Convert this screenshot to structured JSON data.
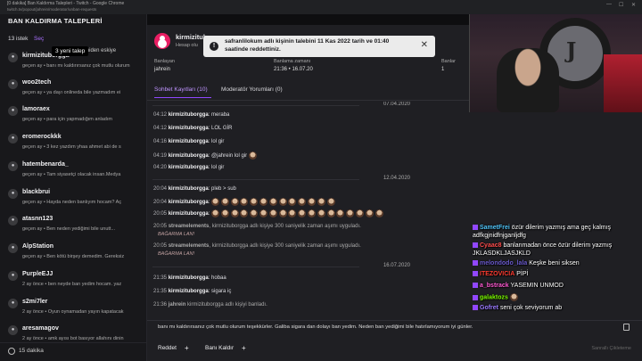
{
  "browser": {
    "title": "[0 dakika] Ban Kaldırma Talepleri - Twitch - Google Chrome",
    "url": "twitch.tv/popout/jahrein/moderator/unban-requests"
  },
  "left_panel": {
    "header": "BAN KALDIRMA TALEPLERİ",
    "count": "13 istek",
    "sec_label": "Seç",
    "sort_label": "Yeniden eskiye",
    "tooltip": "3 yeni talep",
    "requests": [
      {
        "name": "kirmizituborgga",
        "sub": "geçen ay • banı mı kaldırırsanız çok mutlu olurum"
      },
      {
        "name": "woo2tech",
        "sub": "geçen ay • ya dayı onlineda bile yazmadım ei"
      },
      {
        "name": "lamoraex",
        "sub": "geçen ay • para için yapmadığım anladım"
      },
      {
        "name": "eromerockkk",
        "sub": "geçen ay • 3 kez yazdım yhaa ahmet abi de s"
      },
      {
        "name": "hatembenarda_",
        "sub": "geçen ay • Tam siyasetçi olacak insan.Medya"
      },
      {
        "name": "blackbrui",
        "sub": "geçen ay • Hayda neden banlıyım hocam? Aç"
      },
      {
        "name": "atasnn123",
        "sub": "geçen ay • Ben neden yediğimi bile unutt..."
      },
      {
        "name": "AlpStation",
        "sub": "geçen ay • Ben kötü birşey demedim. Gereksiz"
      },
      {
        "name": "PurpleEJJ",
        "sub": "2 ay önce • ben neyde ban yedim hocam. yaz"
      },
      {
        "name": "s2mi7ler",
        "sub": "2 ay önce • Oyun oynamadan yayın kapatacak"
      },
      {
        "name": "aresamagov",
        "sub": "2 ay önce • amk ayısı bot basıyor allahını dinin"
      }
    ],
    "bottom_label": "15 dakika"
  },
  "modal": {
    "user_name": "kirmizituborgga",
    "account_label": "Hesap olu",
    "fields": [
      {
        "label": "Banlayan",
        "value": "jahrein"
      },
      {
        "label": "Banlama zamanı",
        "value": "21:36 • 16.07.20"
      },
      {
        "label": "Banlar",
        "value": "1"
      }
    ],
    "toast": "safranlilokum adlı kişinin talebini 11 Kas 2022 tarih ve 01:40 saatinde reddettiniz.",
    "tabs": [
      "Sohbet Kayıtları (10)",
      "Moderatör Yorumları (0)"
    ],
    "logs": {
      "date1": "07.04.2020",
      "date2": "12.04.2020",
      "date3": "16.07.2020",
      "l1": {
        "time": "04:12",
        "user": "kirmizituborgga",
        "text": ": meraba"
      },
      "l2": {
        "time": "04:12",
        "user": "kirmizituborgga",
        "text": ": LOL GİR"
      },
      "l3": {
        "time": "04:16",
        "user": "kirmizituborgga",
        "text": ": lol gir"
      },
      "l4": {
        "time": "04:19",
        "user": "kirmizituborgga",
        "text": ": @jahrein lol gir"
      },
      "l5": {
        "time": "04:20",
        "user": "kirmizituborgga",
        "text": ": lol gir"
      },
      "l6": {
        "time": "20:04",
        "user": "kirmizituborgga",
        "text": ": pleb > sub"
      },
      "l7": {
        "time": "20:04",
        "user": "kirmizituborgga",
        "text": ":"
      },
      "l8": {
        "time": "20:05",
        "user": "kirmizituborgga",
        "text": ":"
      },
      "s1": {
        "time": "20:05",
        "user": "streamelements",
        "text": ", kirmizituborgga adlı kişiye 300 saniyelik zaman aşımı uyguladı."
      },
      "n1": "BAĞARMA LAN!",
      "s2": {
        "time": "20:05",
        "user": "streamelements",
        "text": ", kirmizituborgga adlı kişiye 300 saniyelik zaman aşımı uyguladı."
      },
      "n2": "BAĞARMA LAN!",
      "l9": {
        "time": "21:35",
        "user": "kirmizituborgga",
        "text": ": hobaa"
      },
      "l10": {
        "time": "21:35",
        "user": "kirmizituborgga",
        "text": ": sigara iç"
      },
      "ban": {
        "time": "21:36",
        "user": "jahrein",
        "text": " kirmizituborgga adlı kişiyi banladı."
      }
    },
    "request_message": "banı mı kaldırırsanız çok mutlu olurum teşekkürler. Galiba sigara dan dolayı ban yedim. Neden ban yediğimi bile hatırlamıyorum iyi günler.",
    "actions": {
      "deny": "Reddet",
      "unban": "Banı Kaldır"
    },
    "watermark": "Sanrallı Çikleteme"
  },
  "overlay_chat": [
    {
      "user": "SametFrei",
      "color": "#4fc3f7",
      "text": " özür dilerim yazmış ama geç kalmış adfkgjnidfnjganljdfg"
    },
    {
      "user": "Cyaac8",
      "color": "#ff4d4d",
      "text": " banlanmadan önce özür dilerim yazmış JKLASDKLJASJKLD"
    },
    {
      "user": "melondodo_lala",
      "color": "#6a5acd",
      "text": " Keşke beni siksen"
    },
    {
      "user": "ITEZOVICIA",
      "color": "#ff3b30",
      "text": " PİPİ"
    },
    {
      "user": "a_bstrack",
      "color": "#ff5ad2",
      "text": " YASEMIN UNMOD"
    },
    {
      "user": "galaktozs",
      "color": "#7cfc00",
      "text": " "
    },
    {
      "user": "Gofret",
      "color": "#9b7bff",
      "text": " seni çok seviyorum ab"
    }
  ]
}
